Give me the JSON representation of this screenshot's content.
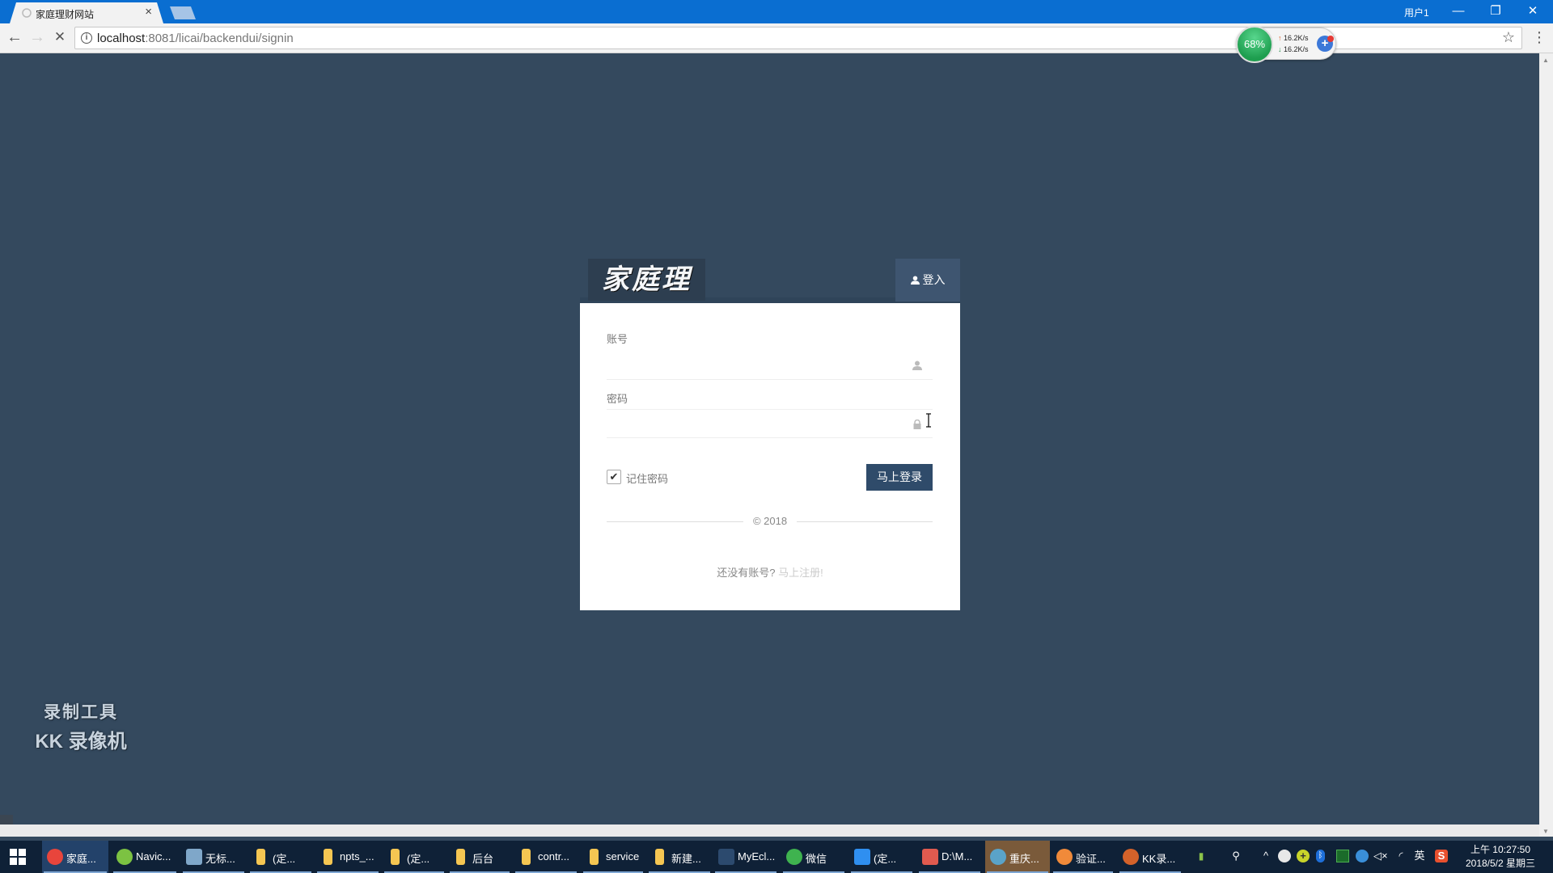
{
  "browser": {
    "tab_title": "家庭理财网站",
    "tab_close": "×",
    "user_label": "用户1",
    "window_controls": {
      "minimize": "—",
      "restore": "❐",
      "close": "✕"
    },
    "nav": {
      "back": "←",
      "forward": "→",
      "stop": "✕"
    },
    "url_host": "localhost",
    "url_rest": ":8081/licai/backendui/signin",
    "star": "☆",
    "menu": "⋮"
  },
  "net_widget": {
    "percent": "68%",
    "upload": "16.2K/s",
    "download": "16.2K/s",
    "plus": "+"
  },
  "login": {
    "logo_text": "家庭理财",
    "tab_label": "登入",
    "account_label": "账号",
    "account_value": "",
    "password_label": "密码",
    "password_value": "",
    "remember_label": "记住密码",
    "remember_checked": true,
    "check_mark": "✔",
    "submit_label": "马上登录",
    "copyright": "© 2018",
    "register_prompt": "还没有账号?",
    "register_link": "马上注册!"
  },
  "watermark": {
    "line1": "录制工具",
    "line2": "KK 录像机"
  },
  "taskbar": {
    "items": [
      {
        "label": "家庭...",
        "icon": "chrome-icon",
        "color": "#e8453c",
        "state": "active"
      },
      {
        "label": "Navic...",
        "icon": "navicat-icon",
        "color": "#7cc242",
        "state": "open"
      },
      {
        "label": "无标...",
        "icon": "window-icon",
        "color": "#7fa7c9",
        "state": "open"
      },
      {
        "label": "(定...",
        "icon": "folder-icon",
        "color": "#f5c652",
        "state": "open"
      },
      {
        "label": "npts_...",
        "icon": "folder-icon",
        "color": "#f5c652",
        "state": "open"
      },
      {
        "label": "(定...",
        "icon": "folder-icon",
        "color": "#f5c652",
        "state": "open"
      },
      {
        "label": "后台",
        "icon": "folder-icon",
        "color": "#f5c652",
        "state": "open"
      },
      {
        "label": "contr...",
        "icon": "folder-icon",
        "color": "#f5c652",
        "state": "open"
      },
      {
        "label": "service",
        "icon": "folder-icon",
        "color": "#f5c652",
        "state": "open"
      },
      {
        "label": "新建...",
        "icon": "folder-icon",
        "color": "#f5c652",
        "state": "open"
      },
      {
        "label": "MyEcl...",
        "icon": "myeclipse-icon",
        "color": "#2c4a6e",
        "state": "open"
      },
      {
        "label": "微信",
        "icon": "wechat-icon",
        "color": "#3fb34f",
        "state": "open"
      },
      {
        "label": "(定...",
        "icon": "wps-icon",
        "color": "#2f8ff0",
        "state": "open"
      },
      {
        "label": "D:\\M...",
        "icon": "notepad-icon",
        "color": "#e05a4f",
        "state": "open"
      },
      {
        "label": "重庆...",
        "icon": "app-icon",
        "color": "#5aa3c8",
        "state": "highlight"
      },
      {
        "label": "验证...",
        "icon": "audio-icon",
        "color": "#f08a3a",
        "state": "open"
      },
      {
        "label": "KK录...",
        "icon": "kk-recorder-icon",
        "color": "#d4622a",
        "state": "open"
      }
    ],
    "tray": {
      "chevron": "^",
      "ime": "英",
      "volume": "🔇"
    },
    "time": "上午 10:27:50",
    "date": "2018/5/2 星期三"
  }
}
